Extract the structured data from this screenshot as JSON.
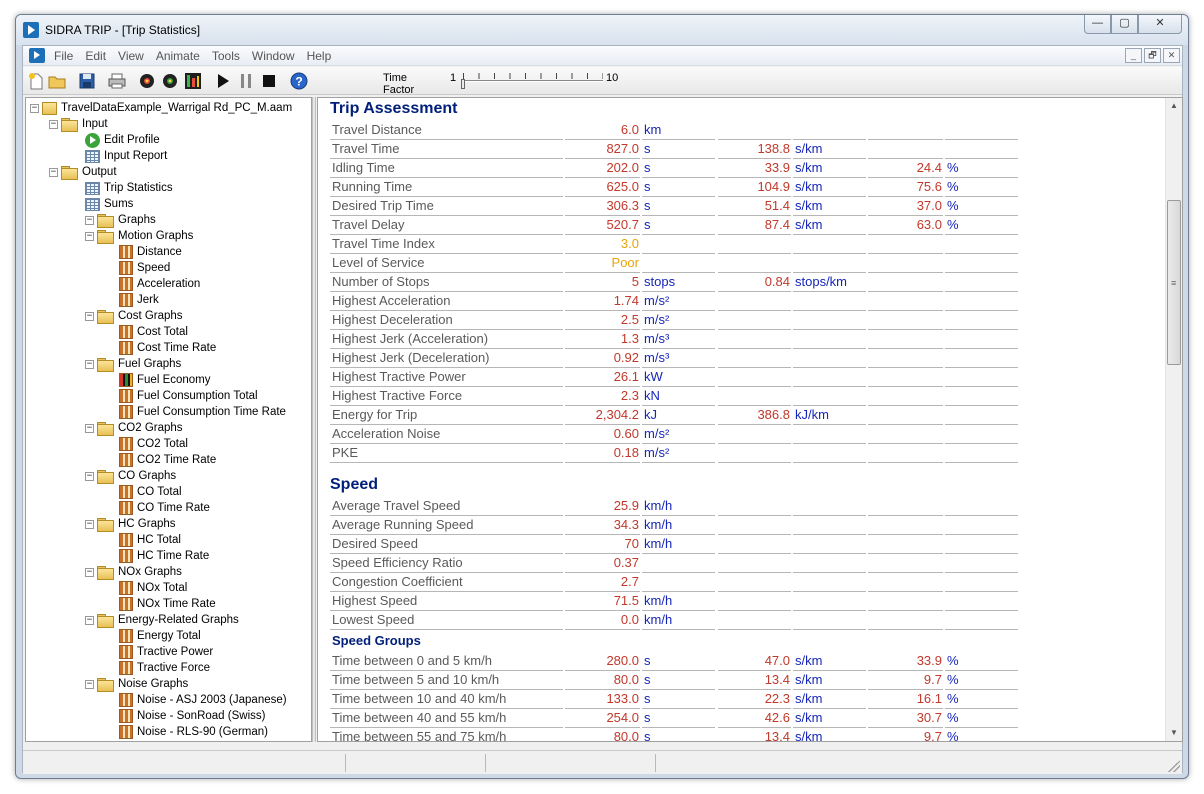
{
  "window": {
    "title": "SIDRA TRIP - [Trip Statistics]",
    "minimize": "—",
    "maximize": "▢",
    "close": "✕"
  },
  "menu": [
    "File",
    "Edit",
    "View",
    "Animate",
    "Tools",
    "Window",
    "Help"
  ],
  "mdi": {
    "minimize": "_",
    "restore": "🗗",
    "close": "✕"
  },
  "toolbar": {
    "buttons": [
      "new-icon",
      "open-icon",
      "save-icon",
      "print-icon",
      "wheel-icon",
      "wheel-alt-icon",
      "bars-icon",
      "play-icon",
      "pause-icon",
      "stop-icon",
      "help-icon"
    ],
    "time_factor_label": "Time Factor",
    "time_factor_min": "1",
    "time_factor_max": "10",
    "time_factor_value": 1
  },
  "tree": [
    {
      "label": "TravelDataExample_Warrigal Rd_PC_M.aam",
      "depth": 0,
      "icon": "root",
      "expander": "−"
    },
    {
      "label": "Input",
      "depth": 1,
      "icon": "folder",
      "expander": "−"
    },
    {
      "label": "Edit Profile",
      "depth": 2,
      "icon": "edit"
    },
    {
      "label": "Input Report",
      "depth": 2,
      "icon": "table"
    },
    {
      "label": "Output",
      "depth": 1,
      "icon": "folder",
      "expander": "−"
    },
    {
      "label": "Trip Statistics",
      "depth": 2,
      "icon": "table"
    },
    {
      "label": "Sums",
      "depth": 2,
      "icon": "table"
    },
    {
      "label": "Graphs",
      "depth": 2,
      "icon": "folder",
      "expander": "−"
    },
    {
      "label": "Motion Graphs",
      "depth": 3,
      "icon": "folder",
      "expander": "−"
    },
    {
      "label": "Distance",
      "depth": 4,
      "icon": "graph"
    },
    {
      "label": "Speed",
      "depth": 4,
      "icon": "graph"
    },
    {
      "label": "Acceleration",
      "depth": 4,
      "icon": "graph"
    },
    {
      "label": "Jerk",
      "depth": 4,
      "icon": "graph"
    },
    {
      "label": "Cost Graphs",
      "depth": 3,
      "icon": "folder",
      "expander": "−"
    },
    {
      "label": "Cost Total",
      "depth": 4,
      "icon": "graph"
    },
    {
      "label": "Cost Time Rate",
      "depth": 4,
      "icon": "graph"
    },
    {
      "label": "Fuel Graphs",
      "depth": 3,
      "icon": "folder",
      "expander": "−"
    },
    {
      "label": "Fuel Economy",
      "depth": 4,
      "icon": "graph-active"
    },
    {
      "label": "Fuel Consumption Total",
      "depth": 4,
      "icon": "graph"
    },
    {
      "label": "Fuel Consumption Time Rate",
      "depth": 4,
      "icon": "graph"
    },
    {
      "label": "CO2 Graphs",
      "depth": 3,
      "icon": "folder",
      "expander": "−"
    },
    {
      "label": "CO2 Total",
      "depth": 4,
      "icon": "graph"
    },
    {
      "label": "CO2 Time Rate",
      "depth": 4,
      "icon": "graph"
    },
    {
      "label": "CO Graphs",
      "depth": 3,
      "icon": "folder",
      "expander": "−"
    },
    {
      "label": "CO Total",
      "depth": 4,
      "icon": "graph"
    },
    {
      "label": "CO Time Rate",
      "depth": 4,
      "icon": "graph"
    },
    {
      "label": "HC Graphs",
      "depth": 3,
      "icon": "folder",
      "expander": "−"
    },
    {
      "label": "HC Total",
      "depth": 4,
      "icon": "graph"
    },
    {
      "label": "HC Time Rate",
      "depth": 4,
      "icon": "graph"
    },
    {
      "label": "NOx Graphs",
      "depth": 3,
      "icon": "folder",
      "expander": "−"
    },
    {
      "label": "NOx Total",
      "depth": 4,
      "icon": "graph"
    },
    {
      "label": "NOx Time Rate",
      "depth": 4,
      "icon": "graph"
    },
    {
      "label": "Energy-Related Graphs",
      "depth": 3,
      "icon": "folder",
      "expander": "−"
    },
    {
      "label": "Energy Total",
      "depth": 4,
      "icon": "graph"
    },
    {
      "label": "Tractive Power",
      "depth": 4,
      "icon": "graph"
    },
    {
      "label": "Tractive Force",
      "depth": 4,
      "icon": "graph"
    },
    {
      "label": "Noise Graphs",
      "depth": 3,
      "icon": "folder",
      "expander": "−"
    },
    {
      "label": "Noise - ASJ 2003 (Japanese)",
      "depth": 4,
      "icon": "graph"
    },
    {
      "label": "Noise - SonRoad (Swiss)",
      "depth": 4,
      "icon": "graph"
    },
    {
      "label": "Noise - RLS-90 (German)",
      "depth": 4,
      "icon": "graph"
    }
  ],
  "report": {
    "sections": [
      {
        "type": "title",
        "text": "Trip Assessment"
      },
      {
        "type": "row",
        "cells": [
          "Travel Distance",
          "6.0",
          "km",
          "",
          "",
          "",
          ""
        ]
      },
      {
        "type": "row",
        "cells": [
          "Travel Time",
          "827.0",
          "s",
          "138.8",
          "s/km",
          "",
          ""
        ]
      },
      {
        "type": "row",
        "cells": [
          "Idling Time",
          "202.0",
          "s",
          "33.9",
          "s/km",
          "24.4",
          "%"
        ]
      },
      {
        "type": "row",
        "cells": [
          "Running Time",
          "625.0",
          "s",
          "104.9",
          "s/km",
          "75.6",
          "%"
        ]
      },
      {
        "type": "row",
        "cells": [
          "Desired Trip Time",
          "306.3",
          "s",
          "51.4",
          "s/km",
          "37.0",
          "%"
        ]
      },
      {
        "type": "row",
        "cells": [
          "Travel Delay",
          "520.7",
          "s",
          "87.4",
          "s/km",
          "63.0",
          "%"
        ]
      },
      {
        "type": "row",
        "amber": true,
        "cells": [
          "Travel Time Index",
          "3.0",
          "",
          "",
          "",
          "",
          ""
        ]
      },
      {
        "type": "row",
        "amber": true,
        "cells": [
          "Level of Service",
          "Poor",
          "",
          "",
          "",
          "",
          ""
        ]
      },
      {
        "type": "row",
        "cells": [
          "Number of Stops",
          "5",
          "stops",
          "0.84",
          "stops/km",
          "",
          ""
        ]
      },
      {
        "type": "row",
        "cells": [
          "Highest Acceleration",
          "1.74",
          "m/s²",
          "",
          "",
          "",
          ""
        ]
      },
      {
        "type": "row",
        "cells": [
          "Highest Deceleration",
          "2.5",
          "m/s²",
          "",
          "",
          "",
          ""
        ]
      },
      {
        "type": "row",
        "cells": [
          "Highest Jerk (Acceleration)",
          "1.3",
          "m/s³",
          "",
          "",
          "",
          ""
        ]
      },
      {
        "type": "row",
        "cells": [
          "Highest Jerk (Deceleration)",
          "0.92",
          "m/s³",
          "",
          "",
          "",
          ""
        ]
      },
      {
        "type": "row",
        "cells": [
          "Highest Tractive Power",
          "26.1",
          "kW",
          "",
          "",
          "",
          ""
        ]
      },
      {
        "type": "row",
        "cells": [
          "Highest Tractive Force",
          "2.3",
          "kN",
          "",
          "",
          "",
          ""
        ]
      },
      {
        "type": "row",
        "cells": [
          "Energy for Trip",
          "2,304.2",
          "kJ",
          "386.8",
          "kJ/km",
          "",
          ""
        ]
      },
      {
        "type": "row",
        "cells": [
          "Acceleration Noise",
          "0.60",
          "m/s²",
          "",
          "",
          "",
          ""
        ]
      },
      {
        "type": "row",
        "cells": [
          "PKE",
          "0.18",
          "m/s²",
          "",
          "",
          "",
          ""
        ]
      },
      {
        "type": "gap"
      },
      {
        "type": "title",
        "text": "Speed"
      },
      {
        "type": "row",
        "cells": [
          "Average Travel Speed",
          "25.9",
          "km/h",
          "",
          "",
          "",
          ""
        ]
      },
      {
        "type": "row",
        "cells": [
          "Average Running Speed",
          "34.3",
          "km/h",
          "",
          "",
          "",
          ""
        ]
      },
      {
        "type": "row",
        "cells": [
          "Desired Speed",
          "70",
          "km/h",
          "",
          "",
          "",
          ""
        ]
      },
      {
        "type": "row",
        "cells": [
          "Speed Efficiency Ratio",
          "0.37",
          "",
          "",
          "",
          "",
          ""
        ]
      },
      {
        "type": "row",
        "cells": [
          "Congestion Coefficient",
          "2.7",
          "",
          "",
          "",
          "",
          ""
        ]
      },
      {
        "type": "row",
        "cells": [
          "Highest Speed",
          "71.5",
          "km/h",
          "",
          "",
          "",
          ""
        ]
      },
      {
        "type": "row",
        "cells": [
          "Lowest Speed",
          "0.0",
          "km/h",
          "",
          "",
          "",
          ""
        ]
      },
      {
        "type": "subtitle",
        "text": "Speed Groups"
      },
      {
        "type": "row",
        "cells": [
          "Time between 0 and 5 km/h",
          "280.0",
          "s",
          "47.0",
          "s/km",
          "33.9",
          "%"
        ]
      },
      {
        "type": "row",
        "cells": [
          "Time between 5 and 10 km/h",
          "80.0",
          "s",
          "13.4",
          "s/km",
          "9.7",
          "%"
        ]
      },
      {
        "type": "row",
        "cells": [
          "Time between 10 and 40 km/h",
          "133.0",
          "s",
          "22.3",
          "s/km",
          "16.1",
          "%"
        ]
      },
      {
        "type": "row",
        "cells": [
          "Time between 40 and 55 km/h",
          "254.0",
          "s",
          "42.6",
          "s/km",
          "30.7",
          "%"
        ]
      },
      {
        "type": "row",
        "cells": [
          "Time between 55 and 75 km/h",
          "80.0",
          "s",
          "13.4",
          "s/km",
          "9.7",
          "%"
        ]
      }
    ]
  },
  "scrollbar": {
    "up": "▲",
    "down": "▼",
    "grip": "≡"
  },
  "colors": {
    "value": "#c0392b",
    "unit": "#1626b8",
    "amber": "#e8a30a",
    "heading": "#001f7a",
    "label": "#5a5a5a"
  }
}
